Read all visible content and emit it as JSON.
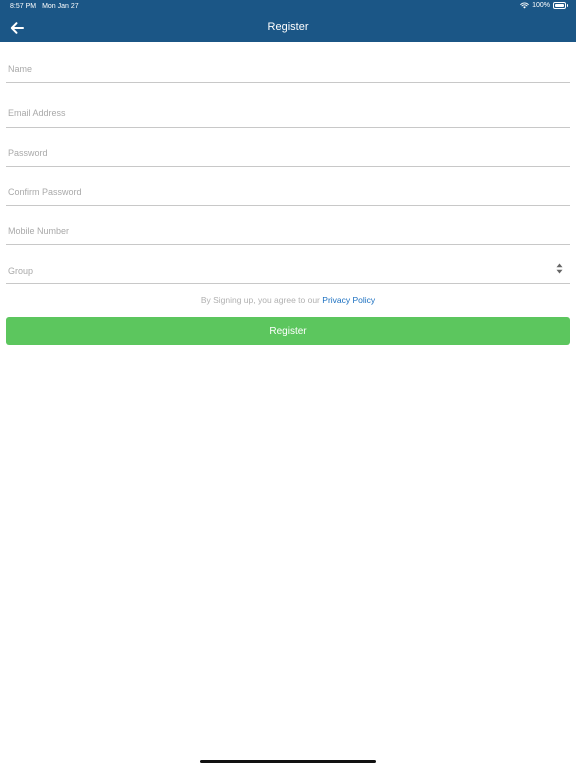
{
  "status_bar": {
    "time": "8:57 PM",
    "date": "Mon Jan 27",
    "battery": "100%",
    "icons": [
      "wifi-icon",
      "battery-icon"
    ]
  },
  "nav": {
    "title": "Register",
    "back_icon": "arrow-left-icon"
  },
  "form": {
    "name_placeholder": "Name",
    "email_placeholder": "Email Address",
    "password_placeholder": "Password",
    "confirm_password_placeholder": "Confirm Password",
    "mobile_placeholder": "Mobile Number",
    "group_placeholder": "Group",
    "group_icon": "sort-arrows-icon"
  },
  "agreement": {
    "text": "By Signing up, you agree to our",
    "link": "Privacy Policy"
  },
  "register_button": {
    "label": "Register"
  },
  "colors": {
    "header": "#1b5686",
    "button": "#5cc65e",
    "link": "#1a6fc0",
    "divider": "#c8c8c8",
    "placeholder": "#a9a9a9"
  }
}
